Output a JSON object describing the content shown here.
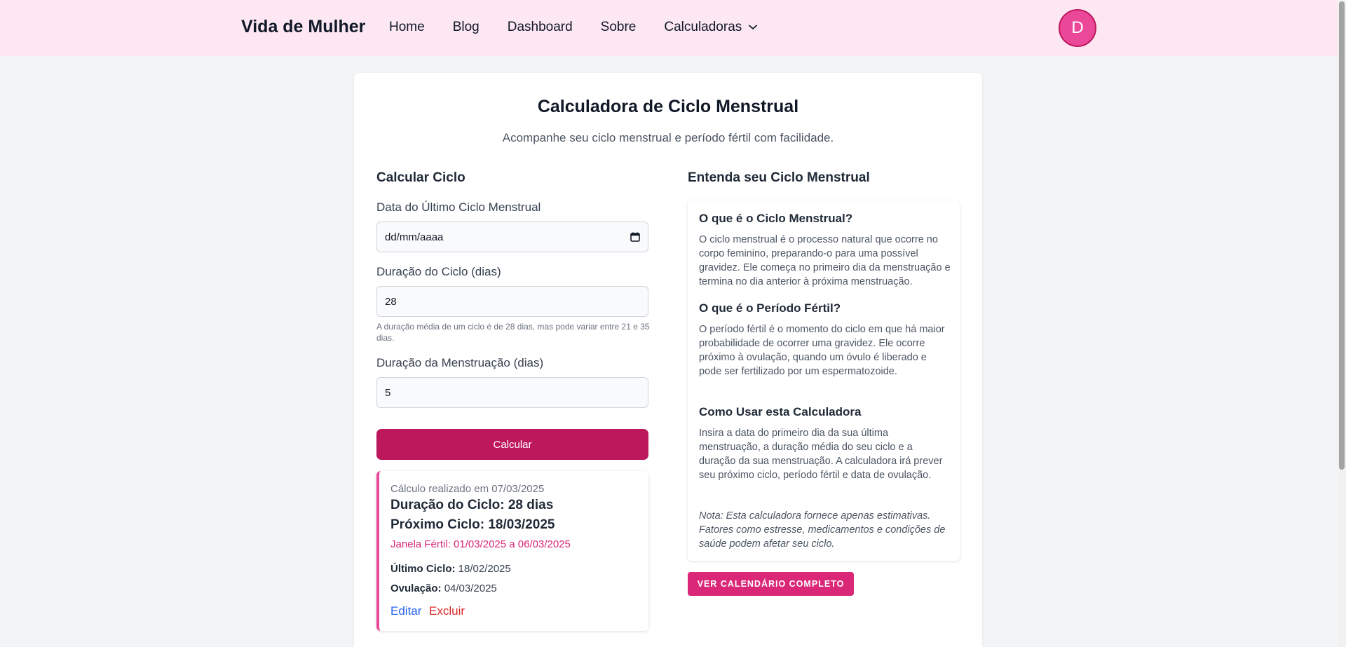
{
  "header": {
    "brand": "Vida de Mulher",
    "nav": [
      "Home",
      "Blog",
      "Dashboard",
      "Sobre",
      "Calculadoras"
    ],
    "avatar_initial": "D"
  },
  "page": {
    "title": "Calculadora de Ciclo Menstrual",
    "subtitle": "Acompanhe seu ciclo menstrual e período fértil com facilidade."
  },
  "form": {
    "heading": "Calcular Ciclo",
    "last_cycle_label": "Data do Último Ciclo Menstrual",
    "last_cycle_placeholder": "dd/mm/aaaa",
    "cycle_length_label": "Duração do Ciclo (dias)",
    "cycle_length_value": "28",
    "cycle_hint": "A duração média de um ciclo é de 28 dias, mas pode variar entre 21 e 35 dias.",
    "period_length_label": "Duração da Menstruação (dias)",
    "period_length_value": "5",
    "submit_label": "Calcular"
  },
  "result": {
    "calculated_on": "Cálculo realizado em 07/03/2025",
    "cycle_length": "Duração do Ciclo: 28 dias",
    "next_cycle": "Próximo Ciclo: 18/03/2025",
    "fertile_window": "Janela Fértil: 01/03/2025 a 06/03/2025",
    "last_cycle_label": "Último Ciclo:",
    "last_cycle_value": "18/02/2025",
    "ovulation_label": "Ovulação:",
    "ovulation_value": "04/03/2025",
    "edit_label": "Editar",
    "delete_label": "Excluir"
  },
  "info": {
    "heading": "Entenda seu Ciclo Menstrual",
    "sections": [
      {
        "title": "O que é o Ciclo Menstrual?",
        "text": "O ciclo menstrual é o processo natural que ocorre no corpo feminino, preparando-o para uma possível gravidez. Ele começa no primeiro dia da menstruação e termina no dia anterior à próxima menstruação."
      },
      {
        "title": "O que é o Período Fértil?",
        "text": "O período fértil é o momento do ciclo em que há maior probabilidade de ocorrer uma gravidez. Ele ocorre próximo à ovulação, quando um óvulo é liberado e pode ser fertilizado por um espermatozoide."
      },
      {
        "title": "Como Usar esta Calculadora",
        "text": "Insira a data do primeiro dia da sua última menstruação, a duração média do seu ciclo e a duração da sua menstruação. A calculadora irá prever seu próximo ciclo, período fértil e data de ovulação."
      }
    ],
    "note": "Nota: Esta calculadora fornece apenas estimativas. Fatores como estresse, medicamentos e condições de saúde podem afetar seu ciclo.",
    "calendar_button": "VER CALENDÁRIO COMPLETO"
  },
  "colors": {
    "header_bg": "#fce7f3",
    "primary": "#be185d",
    "accent": "#db2777",
    "avatar": "#ec4899"
  },
  "icons": [
    "chevron-down-icon",
    "calendar-icon"
  ]
}
